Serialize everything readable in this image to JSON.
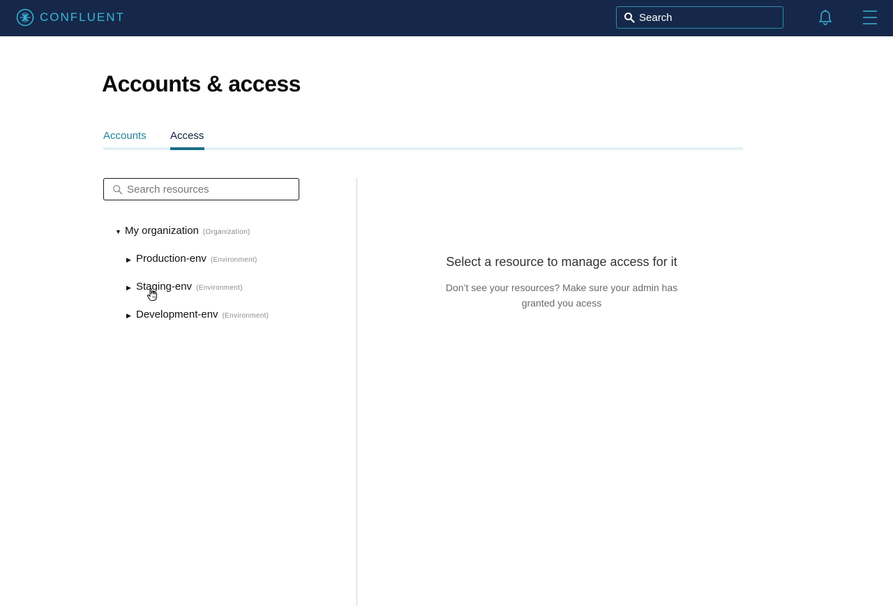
{
  "topbar": {
    "brand": "CONFLUENT",
    "search_placeholder": "Search",
    "icons": {
      "logo": "confluent-logo-icon",
      "search": "search-icon",
      "notifications": "bell-icon",
      "menu": "hamburger-menu-icon"
    },
    "colors": {
      "background": "#16284a",
      "brand": "#39b6d9",
      "search_border": "#2a8fa8"
    }
  },
  "page": {
    "title": "Accounts & access"
  },
  "tabs": [
    {
      "label": "Accounts",
      "active": false
    },
    {
      "label": "Access",
      "active": true
    }
  ],
  "resources": {
    "search_placeholder": "Search resources",
    "tree": {
      "name": "My organization",
      "type": "(Organization)",
      "expanded": true,
      "children": [
        {
          "name": "Production-env",
          "type": "(Environment)",
          "expanded": false
        },
        {
          "name": "Staging-env",
          "type": "(Environment)",
          "expanded": false
        },
        {
          "name": "Development-env",
          "type": "(Environment)",
          "expanded": false
        }
      ]
    }
  },
  "empty_state": {
    "title": "Select a resource to manage access for it",
    "subtitle": "Don’t see your resources? Make sure your admin has granted you acess"
  },
  "colors": {
    "tab_active_text": "#0f1f3c",
    "tab_inactive_text": "#1f7f97",
    "tab_underline": "#1b6f86",
    "tab_track": "#e4f1f4"
  }
}
